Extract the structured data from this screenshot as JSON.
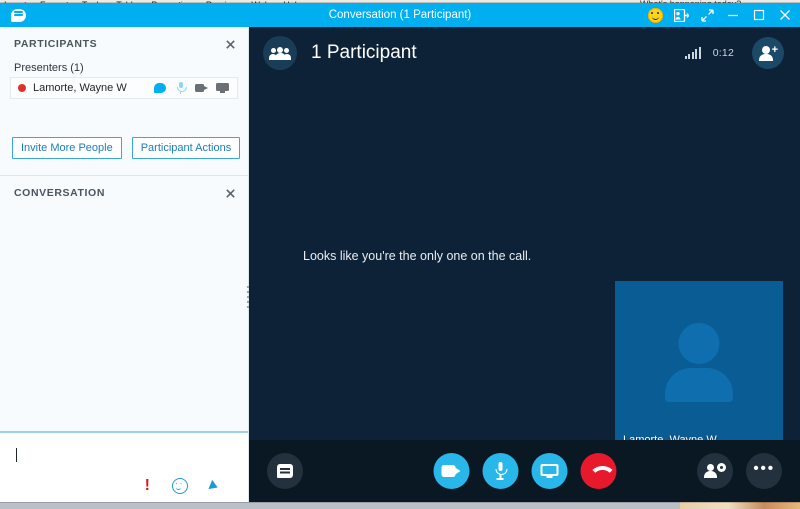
{
  "background": {
    "menu_items": [
      "Insert",
      "Format",
      "Tools",
      "Table",
      "Properties",
      "Preview",
      "Web",
      "Help"
    ],
    "right_text": "What's happening today?"
  },
  "window": {
    "title": "Conversation (1 Participant)",
    "logo_icon": "skype-bubble-icon",
    "controls": {
      "smiley": "smiley-icon",
      "contact_card": "contact-card-icon",
      "fullscreen": "expand-icon",
      "minimize": "minimize-icon",
      "maximize": "maximize-icon",
      "close": "close-icon"
    }
  },
  "participants_panel": {
    "title": "PARTICIPANTS",
    "close_icon": "close-icon",
    "group_label": "Presenters (1)",
    "rows": [
      {
        "name": "Lamorte, Wayne W",
        "presence": "busy",
        "presence_color": "#e02f2f",
        "icons": [
          "im-bubble-icon",
          "microphone-icon",
          "camera-icon",
          "monitor-icon"
        ]
      }
    ],
    "actions": [
      {
        "label": "Invite More People"
      },
      {
        "label": "Participant Actions"
      }
    ]
  },
  "conversation_panel": {
    "title": "CONVERSATION",
    "close_icon": "close-icon",
    "compose": {
      "value": "",
      "placeholder": ""
    },
    "compose_icons": [
      "high-importance-icon",
      "emoticon-icon",
      "send-icon"
    ]
  },
  "stage": {
    "header": {
      "avatar_icon": "group-people-icon",
      "title": "1 Participant",
      "signal_icon": "signal-strength-icon",
      "timer": "0:12",
      "add_participant_icon": "add-person-icon"
    },
    "message": "Looks like you're the only one on the call.",
    "self_tile": {
      "name": "Lamorte, Wayne W",
      "avatar_icon": "person-avatar-icon",
      "tile_color": "#0a5c94",
      "accent_color": "#2fb8ec"
    },
    "toolbar": {
      "chat": {
        "icon": "chat-icon",
        "style": "dark"
      },
      "video": {
        "icon": "video-camera-icon",
        "style": "blue"
      },
      "mic": {
        "icon": "microphone-icon",
        "style": "blue"
      },
      "share_screen": {
        "icon": "present-screen-icon",
        "style": "blue"
      },
      "hang_up": {
        "icon": "hang-up-icon",
        "style": "red"
      },
      "participants": {
        "icon": "people-options-icon",
        "style": "dark"
      },
      "more": {
        "icon": "more-options-icon",
        "style": "dark"
      }
    }
  },
  "colors": {
    "skype_blue": "#00aff0",
    "stage_bg": "#0d2236",
    "toolbar_bg": "#0a1823",
    "accent_blue": "#29b6e8",
    "danger_red": "#e8192c"
  }
}
